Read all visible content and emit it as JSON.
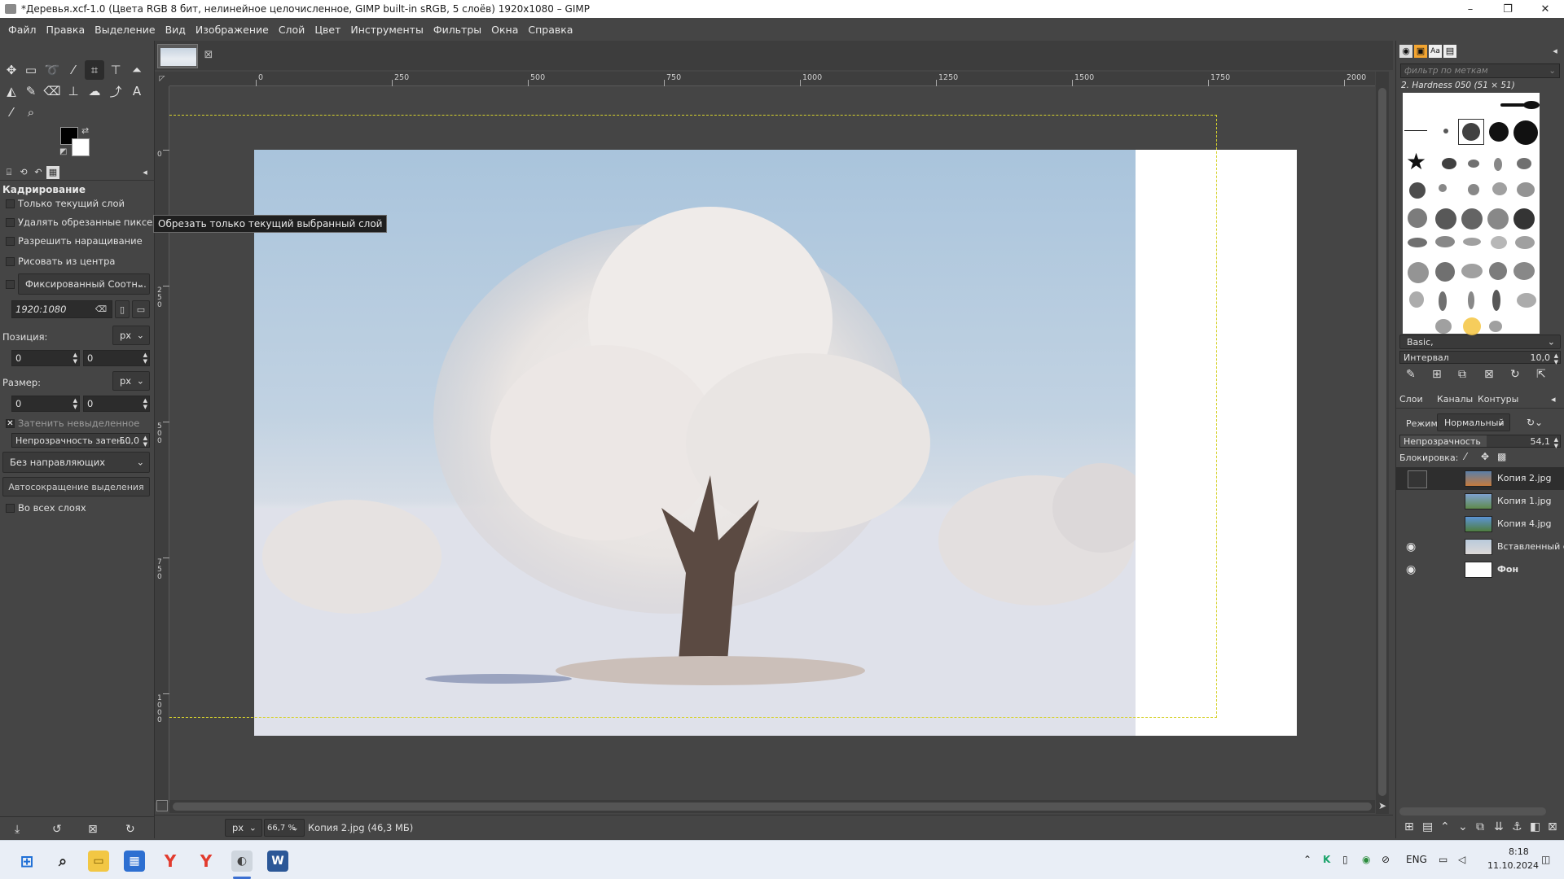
{
  "window": {
    "title": "*Деревья.xcf-1.0 (Цвета RGB 8 бит, нелинейное целочисленное, GIMP built-in sRGB, 5 слоёв) 1920x1080 – GIMP",
    "minimize": "–",
    "maximize": "❐",
    "close": "✕"
  },
  "menu": [
    "Файл",
    "Правка",
    "Выделение",
    "Вид",
    "Изображение",
    "Слой",
    "Цвет",
    "Инструменты",
    "Фильтры",
    "Окна",
    "Справка"
  ],
  "tab": {
    "close": "⊠"
  },
  "tool_options": {
    "title": "Кадрирование",
    "only_current_layer": "Только текущий слой",
    "delete_cropped": "Удалять обрезанные пиксели",
    "allow_growing": "Разрешить наращивание",
    "draw_from_center": "Рисовать из центра",
    "fixed_mode": "Фиксированный Соотн...",
    "ratio_value": "1920:1080",
    "position_label": "Позиция:",
    "position_unit": "px",
    "pos_x": "0",
    "pos_y": "0",
    "size_label": "Размер:",
    "size_unit": "px",
    "size_w": "0",
    "size_h": "0",
    "shade_unselected": "Затенить невыделенное",
    "shade_opacity_label": "Непрозрачность затен...",
    "shade_opacity_value": "50,0",
    "guides": "Без направляющих",
    "autoshrink": "Автосокращение выделения",
    "all_layers": "Во всех слоях"
  },
  "tooltip": "Обрезать только текущий выбранный слой",
  "rulers": {
    "h": [
      "0",
      "250",
      "500",
      "750",
      "1000",
      "1250",
      "1500",
      "1750",
      "2000"
    ],
    "v": [
      "0",
      "250",
      "500",
      "750",
      "1000"
    ]
  },
  "status": {
    "unit": "px",
    "zoom": "66,7 %",
    "info": "Копия 2.jpg (46,3 МБ)"
  },
  "brushes": {
    "filter_placeholder": "фильтр по меткам",
    "current": "2. Hardness 050 (51 × 51)",
    "preset": "Basic,",
    "spacing_label": "Интервал",
    "spacing_value": "10,0"
  },
  "layers_panel": {
    "tabs": [
      "Слои",
      "Каналы",
      "Контуры"
    ],
    "mode_label": "Режим",
    "mode_value": "Нормальный",
    "opacity_label": "Непрозрачность",
    "opacity_value": "54,1",
    "lock_label": "Блокировка:",
    "layers": [
      {
        "name": "Копия 2.jpg",
        "visible": false,
        "selected": true
      },
      {
        "name": "Копия 1.jpg",
        "visible": false,
        "selected": false
      },
      {
        "name": "Копия 4.jpg",
        "visible": false,
        "selected": false
      },
      {
        "name": "Вставленный сл",
        "visible": true,
        "selected": false
      },
      {
        "name": "Фон",
        "visible": true,
        "selected": false
      }
    ]
  },
  "taskbar": {
    "lang": "ENG",
    "time": "8:18",
    "date": "11.10.2024"
  },
  "colors": {
    "accent_crop": "#d6d22d",
    "panel_bg": "#454545"
  }
}
